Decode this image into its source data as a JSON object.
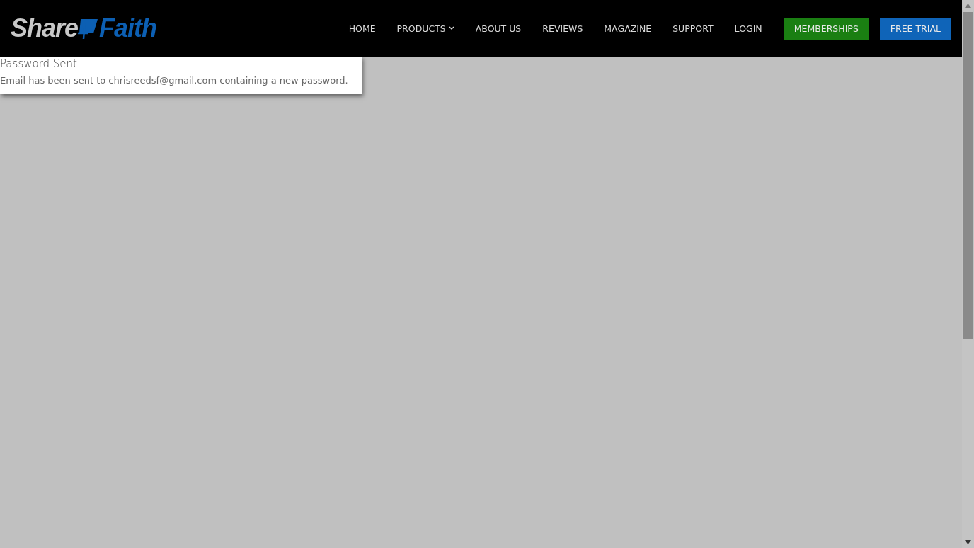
{
  "logo": {
    "left": "Share",
    "right": "Faith"
  },
  "nav": [
    {
      "label": "HOME",
      "kind": "link"
    },
    {
      "label": "PRODUCTS",
      "kind": "dropdown"
    },
    {
      "label": "ABOUT US",
      "kind": "link"
    },
    {
      "label": "REVIEWS",
      "kind": "link"
    },
    {
      "label": "MAGAZINE",
      "kind": "link"
    },
    {
      "label": "SUPPORT",
      "kind": "link"
    },
    {
      "label": "LOGIN",
      "kind": "link"
    },
    {
      "label": "MEMBERSHIPS",
      "kind": "button",
      "color": "#1a7f12"
    },
    {
      "label": "FREE TRIAL",
      "kind": "button",
      "color": "#0f64b8"
    }
  ],
  "notice": {
    "title": "Password Sent",
    "message": "Email has been sent to chrisreedsf@gmail.com containing a new password."
  }
}
